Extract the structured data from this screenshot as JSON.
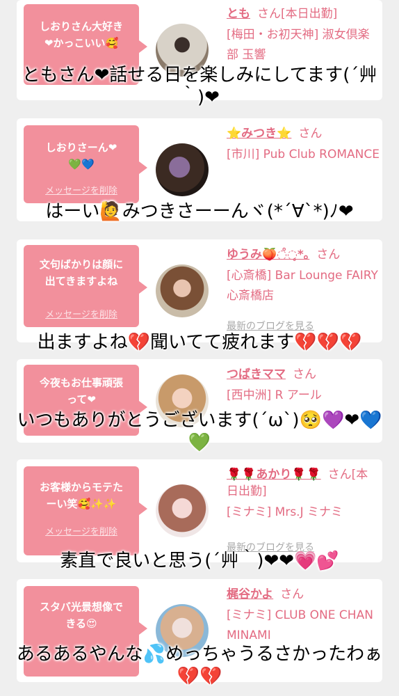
{
  "delete_label": "メッセージを削除",
  "blog_label": "最新のブログを見る",
  "san": "さん",
  "cards": [
    {
      "message": "しおりさん大好き\n❤かっこいい🥰",
      "name": "とも",
      "name_suffix": "さん[本日出勤]",
      "shop": "[梅田・お初天神] 淑女倶楽部 玉響",
      "reply": "ともさん❤話せる日を楽しみにしてます(´艸｀)❤"
    },
    {
      "message": "しおりさーん❤\n💚💙",
      "name": "⭐みつき⭐",
      "name_suffix": "さん",
      "shop": "[市川] Pub Club ROMANCE",
      "reply": "はーい🙋みつきさーーんヾ(*´∀`*)ﾉ❤"
    },
    {
      "message": "文句ばかりは顔に\n出てきますよね",
      "name": "ゆうみ🍑◌̊◌̥*｡",
      "name_suffix": "さん",
      "shop": "[心斎橋] Bar Lounge FAIRY 心斎橋店",
      "reply": "出ますよね💔聞いてて疲れます💔💔💔"
    },
    {
      "message": "今夜もお仕事頑張\nって❤",
      "name": "つばきママ",
      "name_suffix": "さん",
      "shop": "[西中洲] R アール",
      "reply": "いつもありがとうございます(´ω`)🥺💜❤💙💚"
    },
    {
      "message": "お客様からモテた\nーい笑🥰✨✨",
      "name": "🌹🌹あかり🌹🌹",
      "name_suffix": "さん[本日出勤]",
      "shop": "[ミナミ] Mrs.J ミナミ",
      "reply": "素直で良いと思う(´艸｀)❤❤💗💕"
    },
    {
      "message": "スタバ光景想像で\nきる😍",
      "name": "梶谷かよ",
      "name_suffix": "さん",
      "shop": "[ミナミ] CLUB ONE CHAN MINAMI",
      "reply": "あるあるやんな💦めっちゃうるさかったわぁ💔💔"
    }
  ],
  "colors": {
    "accent": "#f2909c",
    "name": "#e36b82",
    "background": "#efefef"
  }
}
